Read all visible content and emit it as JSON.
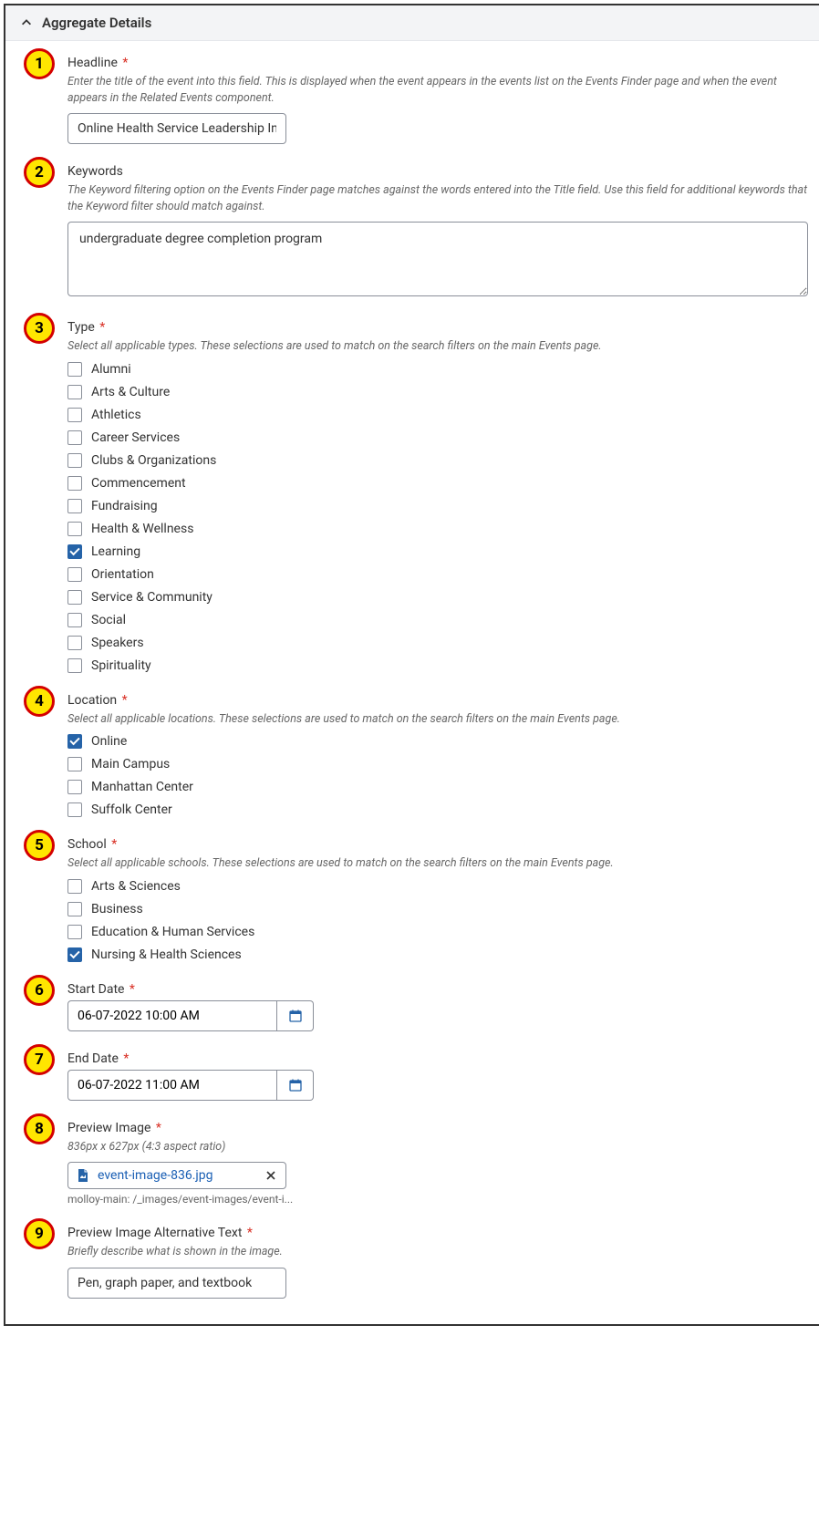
{
  "section_title": "Aggregate Details",
  "fields": {
    "headline": {
      "badge": "1",
      "label": "Headline",
      "required": true,
      "help": "Enter the title of the event into this field. This is displayed when the event appears in the events list on the Events Finder page and when the event appears in the Related Events component.",
      "value": "Online Health Service Leadership Info"
    },
    "keywords": {
      "badge": "2",
      "label": "Keywords",
      "required": false,
      "help": "The Keyword filtering option on the Events Finder page matches against the words entered into the Title field. Use this field for additional keywords that the Keyword filter should match against.",
      "value": "undergraduate degree completion program"
    },
    "type": {
      "badge": "3",
      "label": "Type",
      "required": true,
      "help": "Select all applicable types. These selections are used to match on the search filters on the main Events page.",
      "options": [
        {
          "label": "Alumni",
          "checked": false
        },
        {
          "label": "Arts & Culture",
          "checked": false
        },
        {
          "label": "Athletics",
          "checked": false
        },
        {
          "label": "Career Services",
          "checked": false
        },
        {
          "label": "Clubs & Organizations",
          "checked": false
        },
        {
          "label": "Commencement",
          "checked": false
        },
        {
          "label": "Fundraising",
          "checked": false
        },
        {
          "label": "Health & Wellness",
          "checked": false
        },
        {
          "label": "Learning",
          "checked": true
        },
        {
          "label": "Orientation",
          "checked": false
        },
        {
          "label": "Service & Community",
          "checked": false
        },
        {
          "label": "Social",
          "checked": false
        },
        {
          "label": "Speakers",
          "checked": false
        },
        {
          "label": "Spirituality",
          "checked": false
        }
      ]
    },
    "location": {
      "badge": "4",
      "label": "Location",
      "required": true,
      "help": "Select all applicable locations. These selections are used to match on the search filters on the main Events page.",
      "options": [
        {
          "label": "Online",
          "checked": true
        },
        {
          "label": "Main Campus",
          "checked": false
        },
        {
          "label": "Manhattan Center",
          "checked": false
        },
        {
          "label": "Suffolk Center",
          "checked": false
        }
      ]
    },
    "school": {
      "badge": "5",
      "label": "School",
      "required": true,
      "help": "Select all applicable schools. These selections are used to match on the search filters on the main Events page.",
      "options": [
        {
          "label": "Arts & Sciences",
          "checked": false
        },
        {
          "label": "Business",
          "checked": false
        },
        {
          "label": "Education & Human Services",
          "checked": false
        },
        {
          "label": "Nursing & Health Sciences",
          "checked": true
        }
      ]
    },
    "start_date": {
      "badge": "6",
      "label": "Start Date",
      "required": true,
      "value": "06-07-2022 10:00 AM"
    },
    "end_date": {
      "badge": "7",
      "label": "End Date",
      "required": true,
      "value": "06-07-2022 11:00 AM"
    },
    "preview_image": {
      "badge": "8",
      "label": "Preview Image",
      "required": true,
      "help": "836px x 627px (4:3 aspect ratio)",
      "filename": "event-image-836.jpg",
      "path": "molloy-main: /_images/event-images/event-i..."
    },
    "alt_text": {
      "badge": "9",
      "label": "Preview Image Alternative Text",
      "required": true,
      "help": "Briefly describe what is shown in the image.",
      "value": "Pen, graph paper, and textbook"
    }
  }
}
